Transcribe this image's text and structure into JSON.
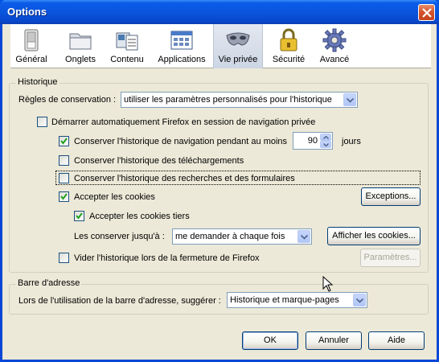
{
  "window": {
    "title": "Options"
  },
  "tabs": [
    {
      "label": "Général",
      "icon": "general-switch-icon"
    },
    {
      "label": "Onglets",
      "icon": "tabs-folder-icon"
    },
    {
      "label": "Contenu",
      "icon": "content-page-icon"
    },
    {
      "label": "Applications",
      "icon": "applications-window-icon"
    },
    {
      "label": "Vie privée",
      "icon": "privacy-mask-icon",
      "selected": true
    },
    {
      "label": "Sécurité",
      "icon": "security-lock-icon"
    },
    {
      "label": "Avancé",
      "icon": "advanced-gear-icon"
    }
  ],
  "history": {
    "legend": "Historique",
    "rules_label": "Règles de conservation :",
    "rules_value": "utiliser les paramètres personnalisés pour l'historique",
    "private_mode": {
      "label": "Démarrer automatiquement Firefox en session de navigation privée",
      "checked": false
    },
    "keep_history": {
      "label": "Conserver l'historique de navigation pendant au moins",
      "checked": true,
      "days": "90",
      "unit": "jours"
    },
    "keep_downloads": {
      "label": "Conserver l'historique des téléchargements",
      "checked": false
    },
    "keep_forms": {
      "label": "Conserver l'historique des recherches et des formulaires",
      "checked": false
    },
    "accept_cookies": {
      "label": "Accepter les cookies",
      "checked": true
    },
    "exceptions_button": "Exceptions...",
    "third_party": {
      "label": "Accepter les cookies tiers",
      "checked": true
    },
    "keep_until_label": "Les conserver jusqu'à :",
    "keep_until_value": "me demander à chaque fois",
    "show_cookies_button": "Afficher les cookies...",
    "clear_on_close": {
      "label": "Vider l'historique lors de la fermeture de Firefox",
      "checked": false
    },
    "settings_button": "Paramètres..."
  },
  "address_bar": {
    "legend": "Barre d'adresse",
    "suggest_label": "Lors de l'utilisation de la barre d'adresse, suggérer :",
    "suggest_value": "Historique et marque-pages"
  },
  "buttons": {
    "ok": "OK",
    "cancel": "Annuler",
    "help": "Aide"
  }
}
